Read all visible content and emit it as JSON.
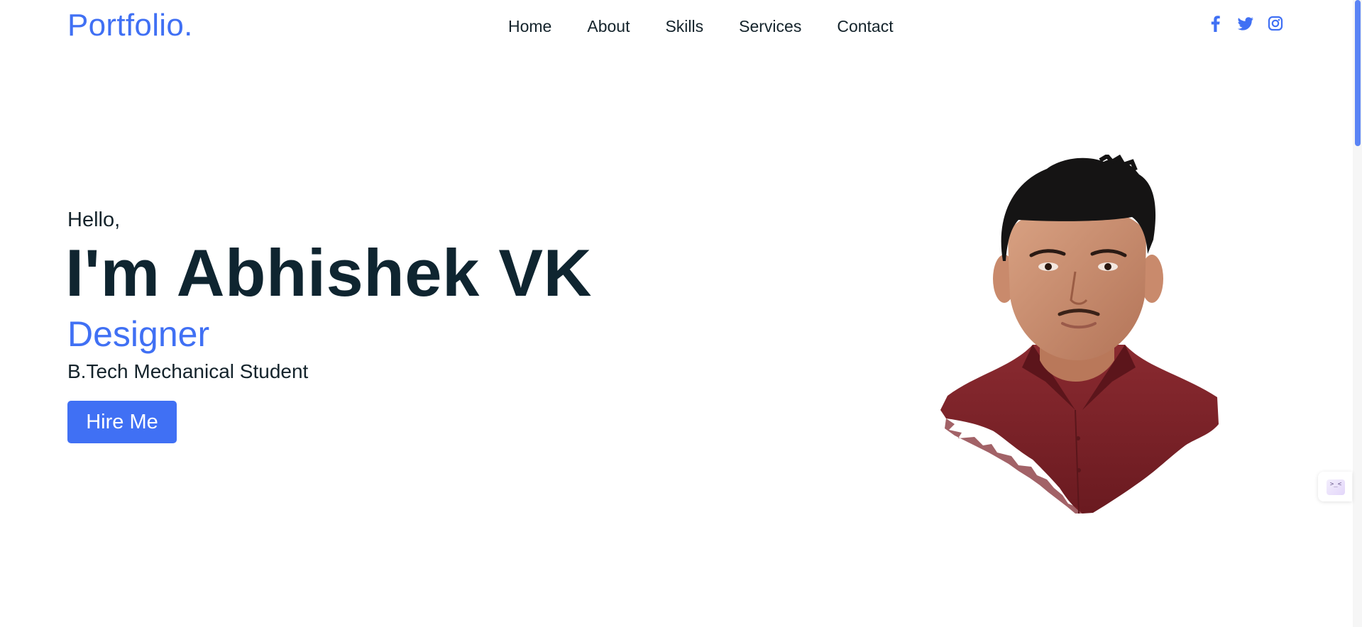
{
  "header": {
    "logo": "Portfolio.",
    "nav": [
      {
        "label": "Home"
      },
      {
        "label": "About"
      },
      {
        "label": "Skills"
      },
      {
        "label": "Services"
      },
      {
        "label": "Contact"
      }
    ],
    "social": [
      {
        "icon": "facebook-icon"
      },
      {
        "icon": "twitter-icon"
      },
      {
        "icon": "instagram-icon"
      }
    ]
  },
  "hero": {
    "greeting": "Hello,",
    "name": "I'm Abhishek VK",
    "role": "Designer",
    "subtitle": "B.Tech Mechanical Student",
    "cta_label": "Hire Me"
  },
  "widget": {
    "icon": "extension-icon",
    "glyph": ">_<"
  },
  "colors": {
    "accent": "#4070f4",
    "heading": "#0f2530",
    "text": "#14232b",
    "shirt": "#7a1f26"
  }
}
